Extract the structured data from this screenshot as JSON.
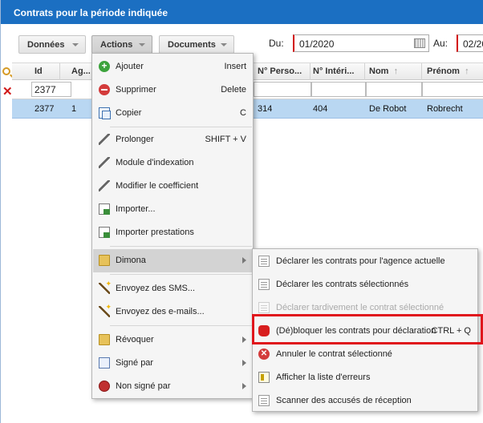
{
  "window": {
    "title": "Contrats pour la période indiquée"
  },
  "toolbar": {
    "donnees_label": "Données",
    "actions_label": "Actions",
    "documents_label": "Documents",
    "du_label": "Du:",
    "du_value": "01/2020",
    "au_label": "Au:",
    "au_value": "02/20"
  },
  "grid": {
    "columns": [
      "Id",
      "Ag...",
      "N° Perso...",
      "N° Intéri...",
      "Nom",
      "Prénom"
    ],
    "filter_id": "2377",
    "row": {
      "id": "2377",
      "ag": "1",
      "perso": "314",
      "interim": "404",
      "nom": "De Robot",
      "prenom": "Robrecht"
    }
  },
  "menu": {
    "items": [
      {
        "label": "Ajouter",
        "shortcut": "Insert",
        "icon": "add-icon"
      },
      {
        "label": "Supprimer",
        "shortcut": "Delete",
        "icon": "delete-icon"
      },
      {
        "label": "Copier",
        "shortcut": "C",
        "icon": "copy-icon"
      },
      {
        "label": "Prolonger",
        "shortcut": "SHIFT + V",
        "icon": "pencil-icon"
      },
      {
        "label": "Module d'indexation",
        "shortcut": "",
        "icon": "pencil-icon"
      },
      {
        "label": "Modifier le coefficient",
        "shortcut": "",
        "icon": "pencil-icon"
      },
      {
        "label": "Importer...",
        "shortcut": "",
        "icon": "import-icon"
      },
      {
        "label": "Importer prestations",
        "shortcut": "",
        "icon": "import-icon"
      },
      {
        "label": "Dimona",
        "shortcut": "",
        "icon": "folder-icon"
      },
      {
        "label": "Envoyez des SMS...",
        "shortcut": "",
        "icon": "wand-icon"
      },
      {
        "label": "Envoyez des e-mails...",
        "shortcut": "",
        "icon": "wand-icon"
      },
      {
        "label": "Révoquer",
        "shortcut": "",
        "icon": "folder-icon"
      },
      {
        "label": "Signé par",
        "shortcut": "",
        "icon": "signed-icon"
      },
      {
        "label": "Non signé par",
        "shortcut": "",
        "icon": "unsigned-icon"
      }
    ]
  },
  "submenu": {
    "items": [
      {
        "label": "Déclarer les contrats pour l'agence actuelle",
        "shortcut": "",
        "icon": "document-icon"
      },
      {
        "label": "Déclarer les contrats sélectionnés",
        "shortcut": "",
        "icon": "document-icon"
      },
      {
        "label": "Déclarer tardivement le contrat sélectionné",
        "shortcut": "",
        "icon": "document-icon"
      },
      {
        "label": "(Dé)bloquer les contrats pour déclaration",
        "shortcut": "CTRL + Q",
        "icon": "hand-icon"
      },
      {
        "label": "Annuler le contrat sélectionné",
        "shortcut": "",
        "icon": "cancel-icon"
      },
      {
        "label": "Afficher la liste d'erreurs",
        "shortcut": "",
        "icon": "error-list-icon"
      },
      {
        "label": "Scanner des accusés de réception",
        "shortcut": "",
        "icon": "document-icon"
      }
    ]
  },
  "colors": {
    "titlebar": "#1b6fc2",
    "selected_row": "#b9d7f2",
    "highlight_box": "#e0151c"
  }
}
